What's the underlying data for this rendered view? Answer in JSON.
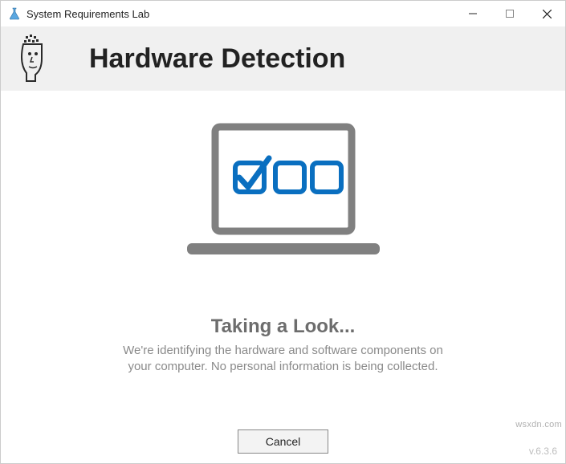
{
  "window": {
    "title": "System Requirements Lab"
  },
  "header": {
    "heading": "Hardware Detection"
  },
  "status": {
    "title": "Taking a Look...",
    "line1": "We're identifying the hardware and software components on",
    "line2": "your computer. No personal information is being collected."
  },
  "footer": {
    "cancel_label": "Cancel",
    "version": "v.6.3.6"
  },
  "watermark": "wsxdn.com",
  "colors": {
    "accent_blue": "#0a6fc0",
    "frame_gray": "#808080"
  }
}
